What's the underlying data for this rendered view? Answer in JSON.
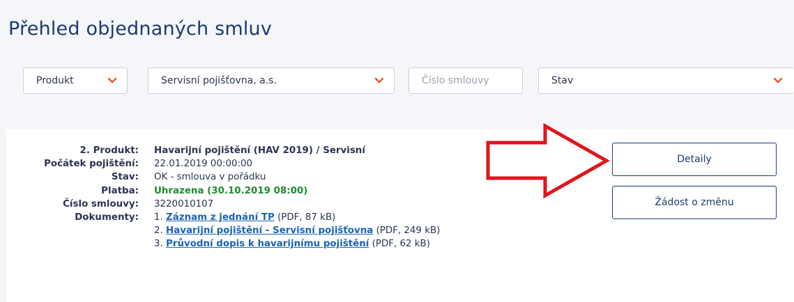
{
  "page": {
    "title": "Přehled objednaných smluv"
  },
  "filters": {
    "product": {
      "label": "Produkt",
      "icon": "chevron-down-icon"
    },
    "insurer": {
      "label": "Servisní pojišťovna, a.s.",
      "icon": "chevron-down-icon"
    },
    "contract_number": {
      "placeholder": "Číslo smlouvy"
    },
    "status": {
      "label": "Stav",
      "icon": "chevron-down-icon"
    },
    "chevron_color": "#e4572e"
  },
  "contract": {
    "product_label": "2. Produkt:",
    "product_value": "Havarijní pojištění (HAV 2019) / Servisní",
    "start_label": "Počátek pojištění:",
    "start_value": "22.01.2019 00:00:00",
    "state_label": "Stav:",
    "state_value": "OK - smlouva v pořádku",
    "payment_label": "Platba:",
    "payment_value": "Uhrazena (30.10.2019 08:00)",
    "number_label": "Číslo smlouvy:",
    "number_value": "3220010107",
    "documents_label": "Dokumenty:",
    "documents": [
      {
        "index": "1.",
        "title": "Záznam z jednání TP",
        "meta": "(PDF, 87 kB)"
      },
      {
        "index": "2.",
        "title": "Havarijní pojištění - Servisní pojišťovna",
        "meta": "(PDF, 249 kB)"
      },
      {
        "index": "3.",
        "title": "Průvodní dopis k havarijnímu pojištění",
        "meta": "(PDF, 62 kB)"
      }
    ]
  },
  "actions": {
    "details_label": "Detaily",
    "change_request_label": "Žádost o změnu"
  },
  "annotation": {
    "arrow_color": "#e0141b",
    "icon": "arrow-right-icon"
  }
}
